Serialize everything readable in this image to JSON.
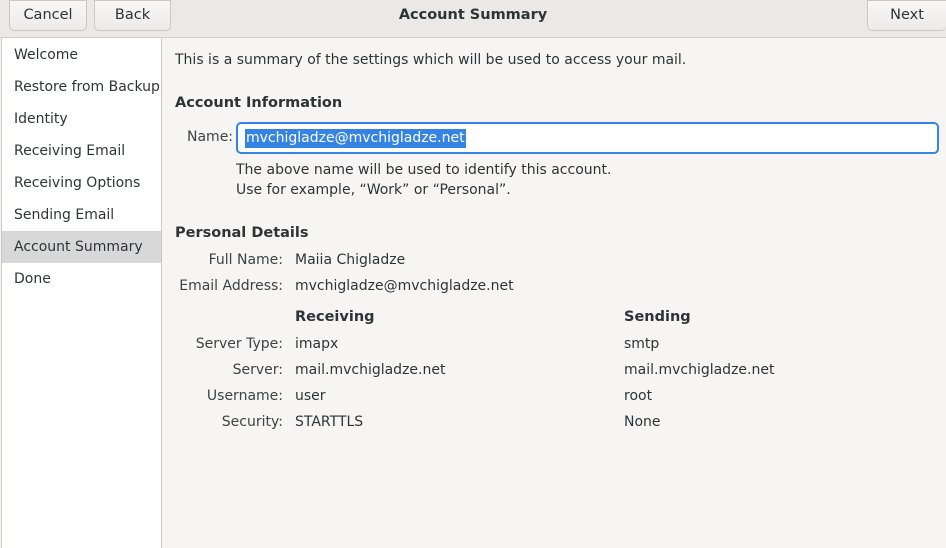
{
  "header": {
    "cancel_label": "Cancel",
    "back_label": "Back",
    "title": "Account Summary",
    "next_label": "Next"
  },
  "sidebar": {
    "items": [
      {
        "label": "Welcome"
      },
      {
        "label": "Restore from Backup"
      },
      {
        "label": "Identity"
      },
      {
        "label": "Receiving Email"
      },
      {
        "label": "Receiving Options"
      },
      {
        "label": "Sending Email"
      },
      {
        "label": "Account Summary"
      },
      {
        "label": "Done"
      }
    ],
    "active": "Account Summary"
  },
  "main": {
    "intro": "This is a summary of the settings which will be used to access your mail.",
    "account_info": {
      "heading": "Account Information",
      "name_label": "Name:",
      "name_value": "mvchigladze@mvchigladze.net",
      "hint_line1": "The above name will be used to identify this account.",
      "hint_line2": "Use for example, “Work” or “Personal”."
    },
    "personal": {
      "heading": "Personal Details",
      "full_name_label": "Full Name:",
      "full_name": "Maiia Chigladze",
      "email_label": "Email Address:",
      "email": "mvchigladze@mvchigladze.net"
    },
    "servers": {
      "receiving_heading": "Receiving",
      "sending_heading": "Sending",
      "server_type_label": "Server Type:",
      "server_label": "Server:",
      "username_label": "Username:",
      "security_label": "Security:",
      "receiving": {
        "type": "imapx",
        "server": "mail.mvchigladze.net",
        "username": "user",
        "security": "STARTTLS"
      },
      "sending": {
        "type": "smtp",
        "server": "mail.mvchigladze.net",
        "username": "root",
        "security": "None"
      }
    }
  },
  "colors": {
    "accent": "#3584e4",
    "sidebar_active": "#d8d8d8"
  }
}
